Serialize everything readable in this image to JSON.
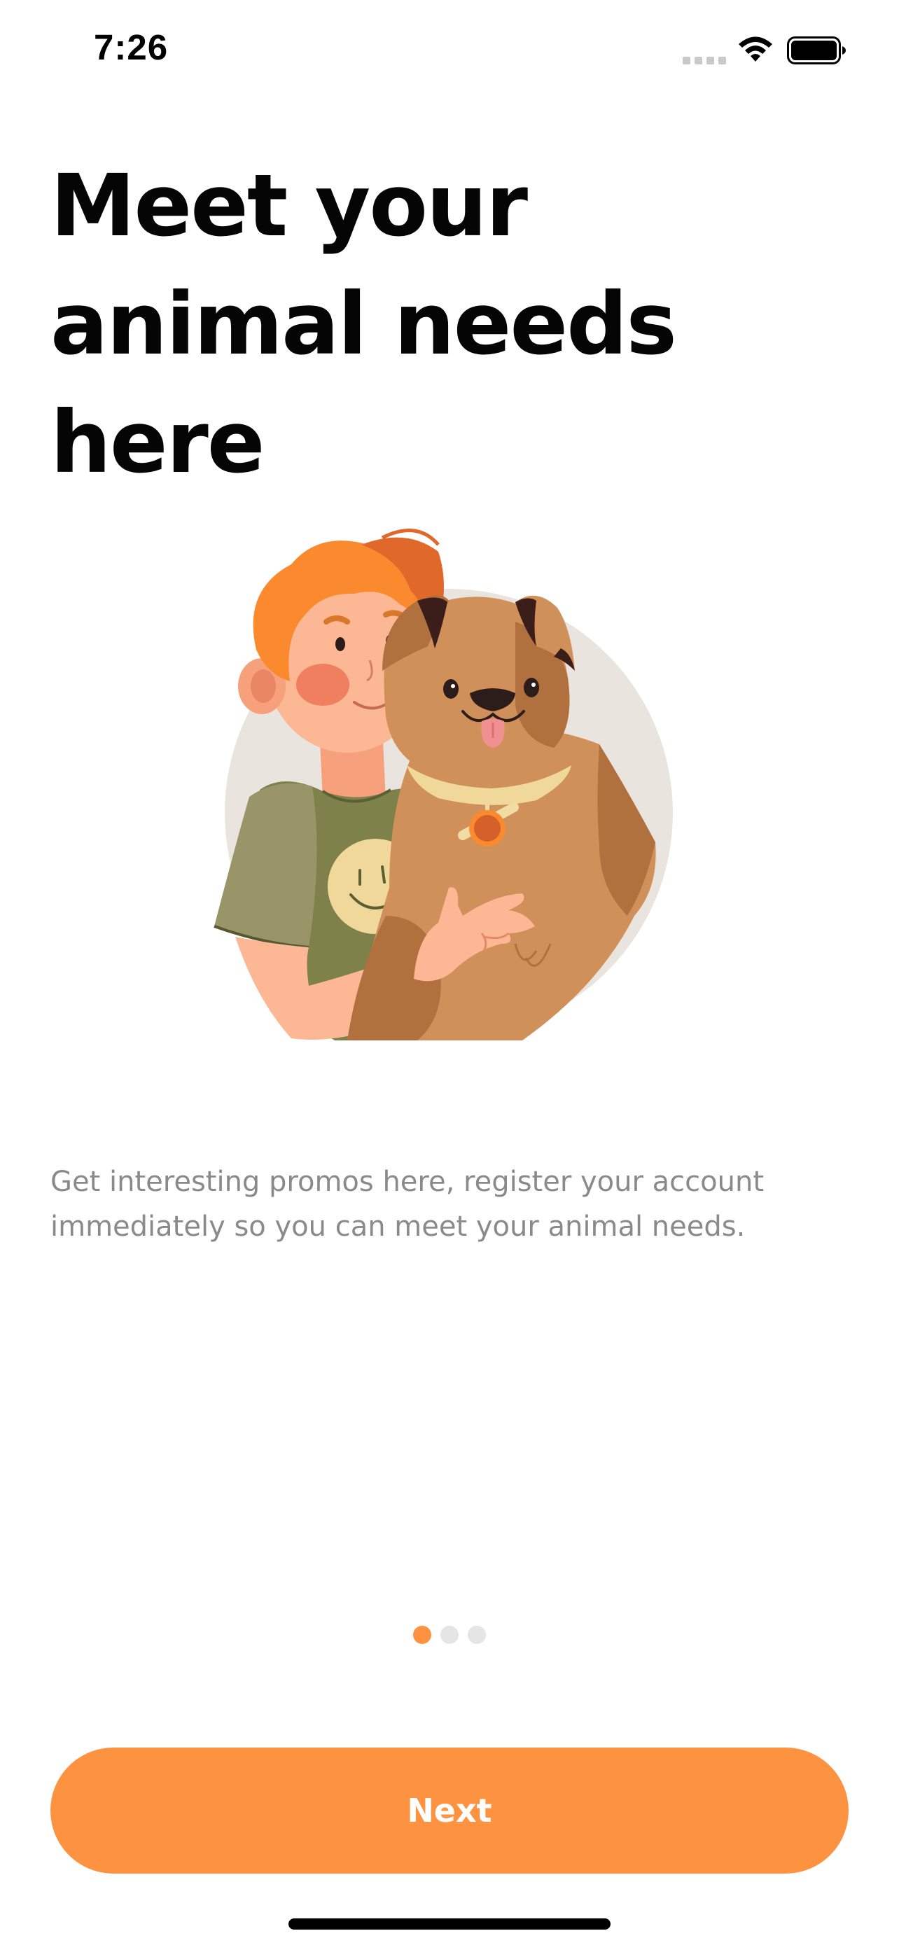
{
  "status_bar": {
    "time": "7:26",
    "icons": [
      "cellular-signal-icon",
      "wifi-icon",
      "battery-icon"
    ]
  },
  "onboarding": {
    "title_lines": [
      "Meet your",
      "animal needs",
      "here"
    ],
    "illustration": "boy-hugging-dog-illustration",
    "description_lines": [
      "Get interesting promos here, register your account",
      "immediately so you can meet your animal needs."
    ],
    "pagination": {
      "total": 3,
      "active_index": 0
    },
    "next_label": "Next"
  },
  "colors": {
    "accent": "#fd9340",
    "title": "#050505",
    "description": "#8a8a8a",
    "dot_inactive": "#e5e5e5"
  }
}
